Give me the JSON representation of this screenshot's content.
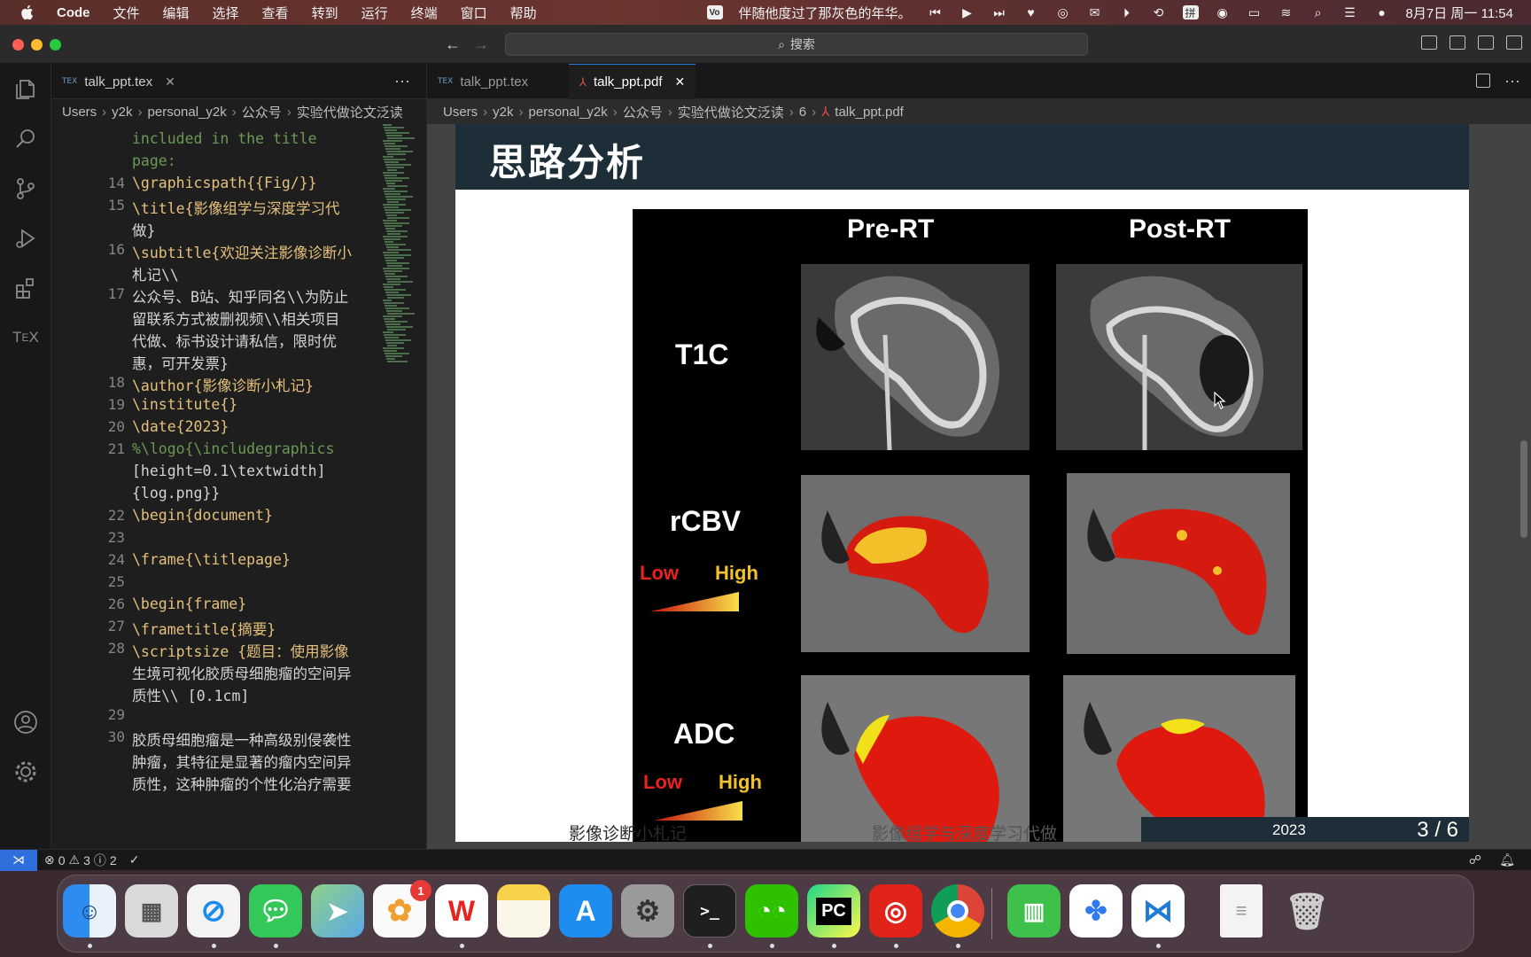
{
  "menubar": {
    "app": "Code",
    "items": [
      "文件",
      "编辑",
      "选择",
      "查看",
      "转到",
      "运行",
      "终端",
      "窗口",
      "帮助"
    ],
    "now_playing": "伴随他度过了那灰色的年华。",
    "datetime": "8月7日 周一 11:54"
  },
  "titlebar": {
    "search_label": "搜索"
  },
  "editor": {
    "tab_label": "talk_ppt.tex",
    "breadcrumb": [
      "Users",
      "y2k",
      "personal_y2k",
      "公众号",
      "实验代做论文泛读"
    ],
    "lines": [
      {
        "num": "",
        "text": "included in the title"
      },
      {
        "num": "",
        "text": "page:"
      },
      {
        "num": "14",
        "text": "\\graphicspath{{Fig/}}"
      },
      {
        "num": "15",
        "text": "\\title{影像组学与深度学习代"
      },
      {
        "num": "",
        "text": "做}"
      },
      {
        "num": "16",
        "text": "\\subtitle{欢迎关注影像诊断小"
      },
      {
        "num": "",
        "text": "札记\\\\"
      },
      {
        "num": "17",
        "text": "公众号、B站、知乎同名\\\\为防止"
      },
      {
        "num": "",
        "text": "留联系方式被删视频\\\\相关项目"
      },
      {
        "num": "",
        "text": "代做、标书设计请私信，限时优"
      },
      {
        "num": "",
        "text": "惠，可开发票}"
      },
      {
        "num": "18",
        "text": "\\author{影像诊断小札记}"
      },
      {
        "num": "19",
        "text": "\\institute{}"
      },
      {
        "num": "20",
        "text": "\\date{2023}"
      },
      {
        "num": "21",
        "text": "%\\logo{\\includegraphics"
      },
      {
        "num": "",
        "text": "[height=0.1\\textwidth]"
      },
      {
        "num": "",
        "text": "{log.png}}"
      },
      {
        "num": "22",
        "text": "\\begin{document}"
      },
      {
        "num": "23",
        "text": ""
      },
      {
        "num": "24",
        "text": "\\frame{\\titlepage}"
      },
      {
        "num": "25",
        "text": ""
      },
      {
        "num": "26",
        "text": "\\begin{frame}"
      },
      {
        "num": "27",
        "text": "\\frametitle{摘要}"
      },
      {
        "num": "28",
        "text": "\\scriptsize {题目：使用影像"
      },
      {
        "num": "",
        "text": "生境可视化胶质母细胞瘤的空间异"
      },
      {
        "num": "",
        "text": "质性\\\\ [0.1cm]"
      },
      {
        "num": "29",
        "text": ""
      },
      {
        "num": "30",
        "text": "胶质母细胞瘤是一种高级别侵袭性"
      },
      {
        "num": "",
        "text": "肿瘤，其特征是显著的瘤内空间异"
      },
      {
        "num": "",
        "text": "质性，这种肿瘤的个性化治疗需要"
      }
    ]
  },
  "pdfpane": {
    "tab_tex": "talk_ppt.tex",
    "tab_pdf": "talk_ppt.pdf",
    "breadcrumb": [
      "Users",
      "y2k",
      "personal_y2k",
      "公众号",
      "实验代做论文泛读",
      "6",
      "talk_ppt.pdf"
    ],
    "slide": {
      "title": "思路分析",
      "col_pre": "Pre-RT",
      "col_post": "Post-RT",
      "row_t1c": "T1C",
      "row_rcbv": "rCBV",
      "row_adc": "ADC",
      "low": "Low",
      "high": "High",
      "footer_author": "影像诊断小札记",
      "footer_title": "影像组学与深度学习代做",
      "footer_year": "2023",
      "footer_page": "3 / 6"
    }
  },
  "statusbar": {
    "errors": "0",
    "warnings": "3",
    "info": "2"
  },
  "dock": {
    "apps": [
      "finder-icon",
      "launchpad-icon",
      "safari-icon",
      "messages-icon",
      "maps-icon",
      "photos-icon",
      "wps-icon",
      "notes-icon",
      "app-store-icon",
      "system-settings-icon",
      "terminal-icon",
      "wechat-icon",
      "pycharm-icon",
      "netease-music-icon",
      "chrome-icon",
      "archive-icon",
      "baidu-netdisk-icon",
      "vscode-icon",
      "document-icon",
      "trash-icon"
    ],
    "photos_badge": "1"
  }
}
